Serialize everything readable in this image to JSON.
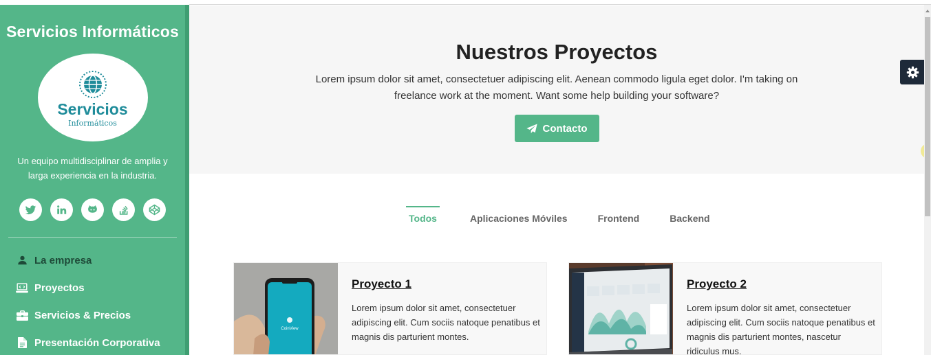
{
  "sidebar": {
    "brand": "Servicios Informáticos",
    "logo": {
      "main": "Servicios",
      "sub": "Informáticos"
    },
    "tagline": "Un equipo multidisciplinar de amplia y larga experiencia en la industria.",
    "social": [
      "twitter-icon",
      "linkedin-icon",
      "github-icon",
      "stackoverflow-icon",
      "codepen-icon"
    ],
    "nav": [
      {
        "label": "La empresa",
        "icon": "user-icon"
      },
      {
        "label": "Proyectos",
        "icon": "laptop-code-icon"
      },
      {
        "label": "Servicios & Precios",
        "icon": "briefcase-icon"
      },
      {
        "label": "Presentación Corporativa",
        "icon": "file-icon"
      }
    ]
  },
  "hero": {
    "title": "Nuestros Proyectos",
    "description": "Lorem ipsum dolor sit amet, consectetuer adipiscing elit. Aenean commodo ligula eget dolor. I'm taking on freelance work at the moment. Want some help building your software?",
    "button": "Contacto"
  },
  "tabs": [
    "Todos",
    "Aplicaciones Móviles",
    "Frontend",
    "Backend"
  ],
  "projects": [
    {
      "title": "Proyecto 1",
      "text": "Lorem ipsum dolor sit amet, consectetuer adipiscing elit. Cum sociis natoque penatibus et magnis dis parturient montes.",
      "app_name": "CoinView"
    },
    {
      "title": "Proyecto 2",
      "text": "Lorem ipsum dolor sit amet, consectetuer adipiscing elit. Cum sociis natoque penatibus et magnis dis parturient montes, nascetur ridiculus mus."
    }
  ],
  "colors": {
    "accent": "#54b689",
    "logo": "#1f8c9a",
    "settings": "#1e2a39"
  }
}
